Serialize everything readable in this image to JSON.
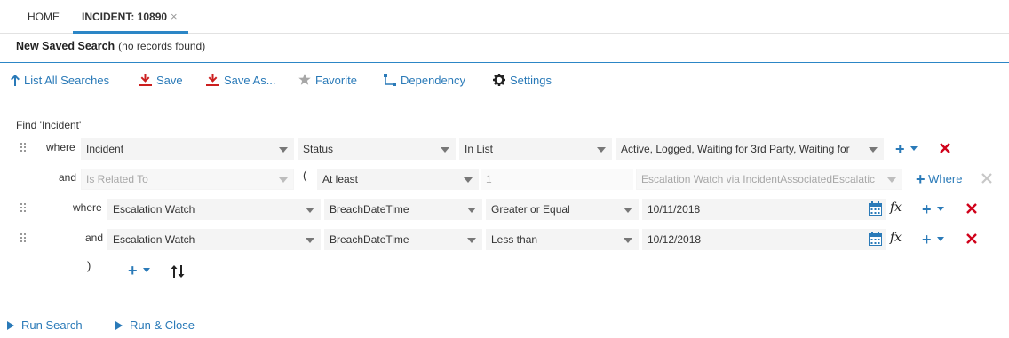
{
  "tabs": [
    {
      "label": "HOME"
    },
    {
      "label": "INCIDENT: 10890",
      "close": "×"
    }
  ],
  "title": {
    "name": "New Saved Search",
    "count": "(no records found)"
  },
  "toolbar": {
    "list_all": "List All Searches",
    "save": "Save",
    "save_as": "Save As...",
    "favorite": "Favorite",
    "dependency": "Dependency",
    "settings": "Settings"
  },
  "find_label": "Find 'Incident'",
  "rows": [
    {
      "conj": "where",
      "object": "Incident",
      "field": "Status",
      "operator": "In List",
      "value": "Active, Logged, Waiting for 3rd Party, Waiting for"
    },
    {
      "conj": "and",
      "object": "Is Related To",
      "paren": "(",
      "operator": "At least",
      "count": "1",
      "relation": "Escalation Watch via IncidentAssociatedEscalatic",
      "where_label": "Where"
    },
    {
      "conj": "where",
      "object": "Escalation Watch",
      "field": "BreachDateTime",
      "operator": "Greater or Equal",
      "value": "10/11/2018"
    },
    {
      "conj": "and",
      "object": "Escalation Watch",
      "field": "BreachDateTime",
      "operator": "Less than",
      "value": "10/12/2018"
    }
  ],
  "close_paren": ")",
  "fx_label": "fx",
  "bottom": {
    "run_search": "Run Search",
    "run_close": "Run & Close"
  },
  "colors": {
    "accent": "#2c86c6",
    "link": "#2a7ab8",
    "delete": "#d0021b"
  }
}
